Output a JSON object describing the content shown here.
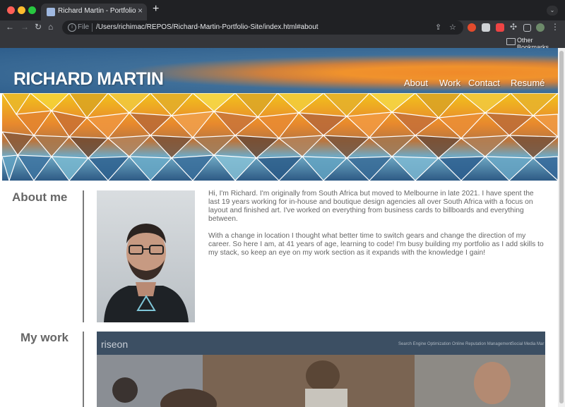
{
  "browser": {
    "tab_title": "Richard Martin - Portfolio",
    "tab_close": "×",
    "new_tab": "+",
    "url_scheme": "File",
    "url": "/Users/richimac/REPOS/Richard-Martin-Portfolio-Site/index.html#about",
    "bookmarks_label": "Other Bookmarks"
  },
  "header": {
    "title": "RICHARD MARTIN",
    "nav": [
      "About",
      "Work",
      "Contact",
      "Resumé"
    ]
  },
  "about": {
    "heading": "About me",
    "paragraphs": [
      "Hi, I'm Richard. I'm originally from South Africa but moved to Melbourne in late 2021. I have spent the last 19 years working for in-house and boutique design agencies all over South Africa with a focus on layout and finished art. I've worked on everything from business cards to billboards and everything between.",
      "With a change in location I thought what better time to switch gears and change the direction of my career. So here I am, at 41 years of age, learning to code! I'm busy building my portfolio as I add skills to my stack, so keep an eye on my work section as it expands with the knowledge I gain!"
    ]
  },
  "work": {
    "heading": "My work",
    "preview_logo": "riseon",
    "preview_nav": [
      "Search Engine Optimization",
      "Online Reputation Management",
      "Social Media Mar"
    ]
  },
  "colors": {
    "header_blue": "#2e5e8c",
    "header_orange": "#f08a2a",
    "heading_gray": "#666666"
  }
}
